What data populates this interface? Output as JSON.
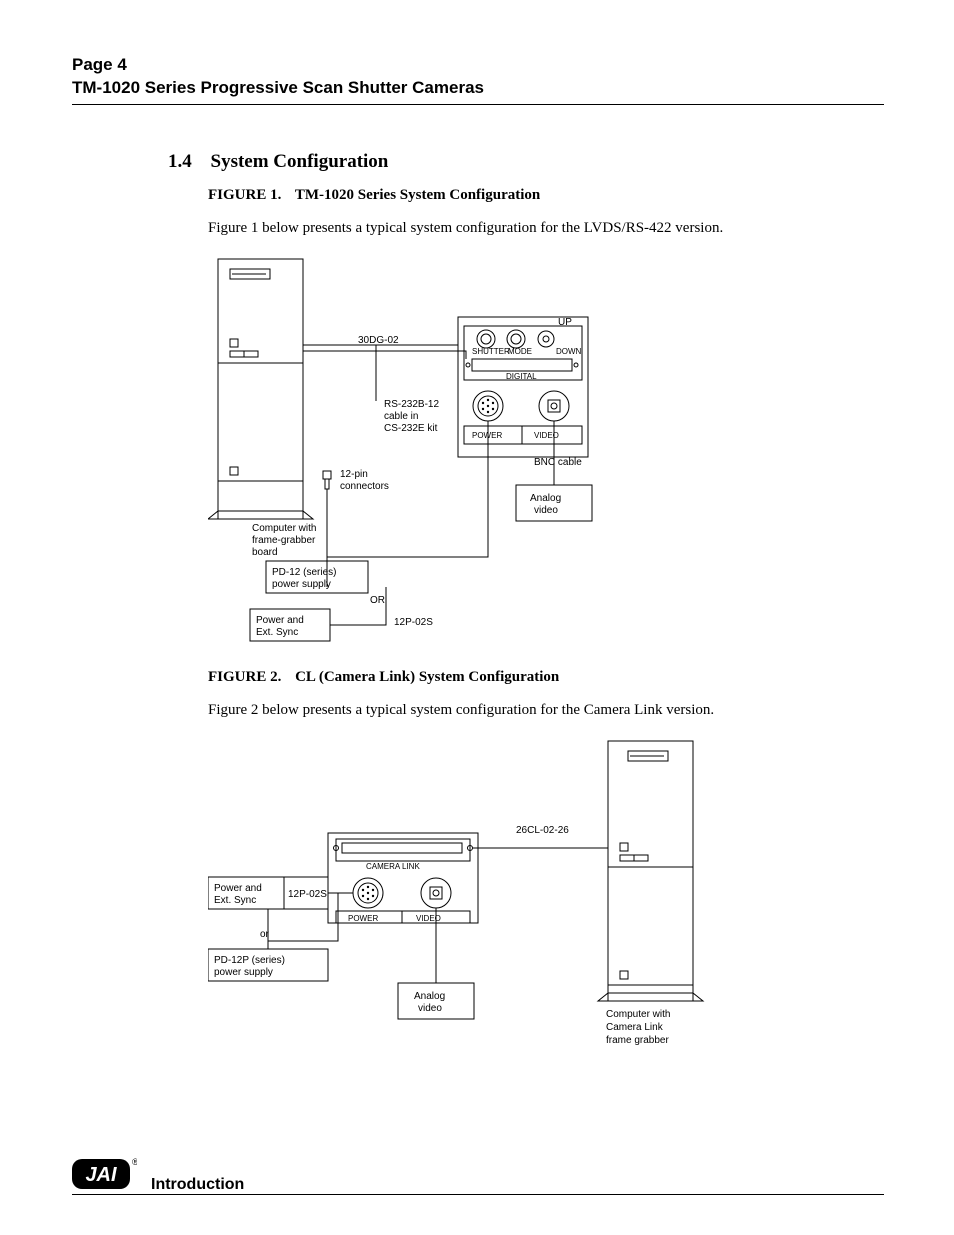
{
  "header": {
    "page_label": "Page 4",
    "doc_title": "TM-1020 Series Progressive Scan Shutter Cameras"
  },
  "section": {
    "number": "1.4",
    "title": "System Configuration"
  },
  "figure1": {
    "label": "FIGURE 1.",
    "title": "TM-1020 Series System Configuration",
    "desc": "Figure 1 below presents a typical system configuration for the LVDS/RS-422 version.",
    "labels": {
      "computer": "Computer with\nframe-grabber\nboard",
      "pd12": "PD-12 (series)\npower supply",
      "or": "OR",
      "power_sync": "Power and\nExt. Sync",
      "twelve_p": "12P-02S",
      "twelve_pin": "12-pin\nconnectors",
      "thirty_dg": "30DG-02",
      "rs232": "RS-232B-12\ncable in\nCS-232E kit",
      "shutter": "SHUTTER",
      "mode": "MODE",
      "up": "UP",
      "down": "DOWN",
      "digital": "DIGITAL",
      "power": "POWER",
      "video": "VIDEO",
      "bnc": "BNC cable",
      "analog": "Analog\nvideo"
    }
  },
  "figure2": {
    "label": "FIGURE 2.",
    "title": "CL (Camera Link) System Configuration",
    "desc": "Figure 2 below presents a typical system configuration for the Camera Link version.",
    "labels": {
      "camera_link": "CAMERA LINK",
      "power": "POWER",
      "video": "VIDEO",
      "twenty_six": "26CL-02-26",
      "power_sync": "Power and\nExt. Sync",
      "twelve_p": "12P-02S",
      "or": "or",
      "pd12p": "PD-12P (series)\npower supply",
      "analog": "Analog\nvideo",
      "computer": "Computer with\nCamera Link\nframe grabber"
    }
  },
  "footer": {
    "section": "Introduction",
    "logo_text": "JAI",
    "registered": "®"
  }
}
